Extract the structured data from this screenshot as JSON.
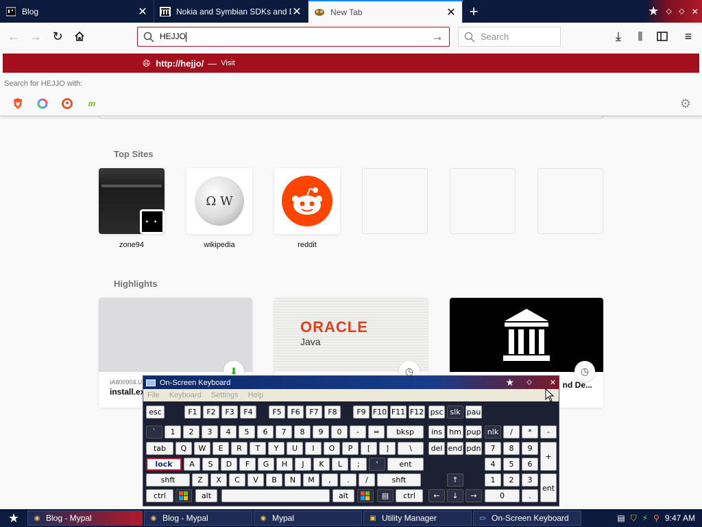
{
  "tabs": [
    {
      "title": "Blog",
      "favicon": "terminal-icon"
    },
    {
      "title": "Nokia and Symbian SDKs and Dev",
      "favicon": "archive-columns-icon"
    },
    {
      "title": "New Tab",
      "favicon": "mypal-icon",
      "active": true
    }
  ],
  "urlbar": {
    "value": "HEJJO"
  },
  "searchbar": {
    "placeholder": "Search"
  },
  "dropdown": {
    "url": "http://hejjo/",
    "separator": "—",
    "action": "Visit",
    "search_for": "Search for HEJJO with:",
    "engines": [
      "brave-icon",
      "qwant-icon",
      "duckduckgo-icon",
      "mojeek-icon"
    ]
  },
  "newtab": {
    "top_sites_title": "Top Sites",
    "top_sites": [
      {
        "label": "zone94"
      },
      {
        "label": "wikipedia"
      },
      {
        "label": "reddit"
      },
      {
        "label": ""
      },
      {
        "label": ""
      },
      {
        "label": ""
      }
    ],
    "highlights_title": "Highlights",
    "highlights": [
      {
        "host": "IA800904.U",
        "title": "install.ex"
      },
      {
        "host": "",
        "title": "",
        "brand": "ORACLE",
        "subtitle": "Java"
      },
      {
        "host": "",
        "title": "nd De..."
      }
    ]
  },
  "osk": {
    "title": "On-Screen Keyboard",
    "menu": [
      "File",
      "Keyboard",
      "Settings",
      "Help"
    ],
    "keys": {
      "esc": "esc",
      "f1": "F1",
      "f2": "F2",
      "f3": "F3",
      "f4": "F4",
      "f5": "F5",
      "f6": "F6",
      "f7": "F7",
      "f8": "F8",
      "f9": "F9",
      "f10": "F10",
      "f11": "F11",
      "f12": "F12",
      "psc": "psc",
      "slk": "slk",
      "pau": "pau",
      "backtick": "`",
      "n1": "1",
      "n2": "2",
      "n3": "3",
      "n4": "4",
      "n5": "5",
      "n6": "6",
      "n7": "7",
      "n8": "8",
      "n9": "9",
      "n0": "0",
      "minus": "-",
      "equals": "=",
      "bksp": "bksp",
      "ins": "ins",
      "hm": "hm",
      "pup": "pup",
      "nlk": "nlk",
      "kslash": "/",
      "kstar": "*",
      "kminus": "-",
      "tab": "tab",
      "q": "Q",
      "w": "W",
      "e": "E",
      "r": "R",
      "t": "T",
      "y": "Y",
      "u": "U",
      "i": "I",
      "o": "O",
      "p": "P",
      "lbr": "[",
      "rbr": "]",
      "bslash": "\\",
      "del": "del",
      "end": "end",
      "pdn": "pdn",
      "k7": "7",
      "k8": "8",
      "k9": "9",
      "kplus": "+",
      "lock": "lock",
      "a": "A",
      "s": "S",
      "d": "D",
      "f": "F",
      "g": "G",
      "h": "H",
      "j": "J",
      "k": "K",
      "l": "L",
      "semi": ";",
      "quote": "'",
      "ent": "ent",
      "k4": "4",
      "k5": "5",
      "k6": "6",
      "shft": "shft",
      "z": "Z",
      "x": "X",
      "c": "C",
      "v": "V",
      "b": "B",
      "n": "N",
      "m": "M",
      "comma": ",",
      "period": ".",
      "fslash": "/",
      "shft2": "shft",
      "k1": "1",
      "k2": "2",
      "k3": "3",
      "kent": "ent",
      "ctrl": "ctrl",
      "alt": "alt",
      "alt2": "alt",
      "ctrl2": "ctrl",
      "k0": "0",
      "kdot": "."
    }
  },
  "taskbar": {
    "tasks": [
      "Blog - Mypal",
      "Blog - Mypal",
      "Mypal",
      "Utility Manager",
      "On-Screen Keyboard"
    ],
    "clock": "9:47 AM"
  }
}
